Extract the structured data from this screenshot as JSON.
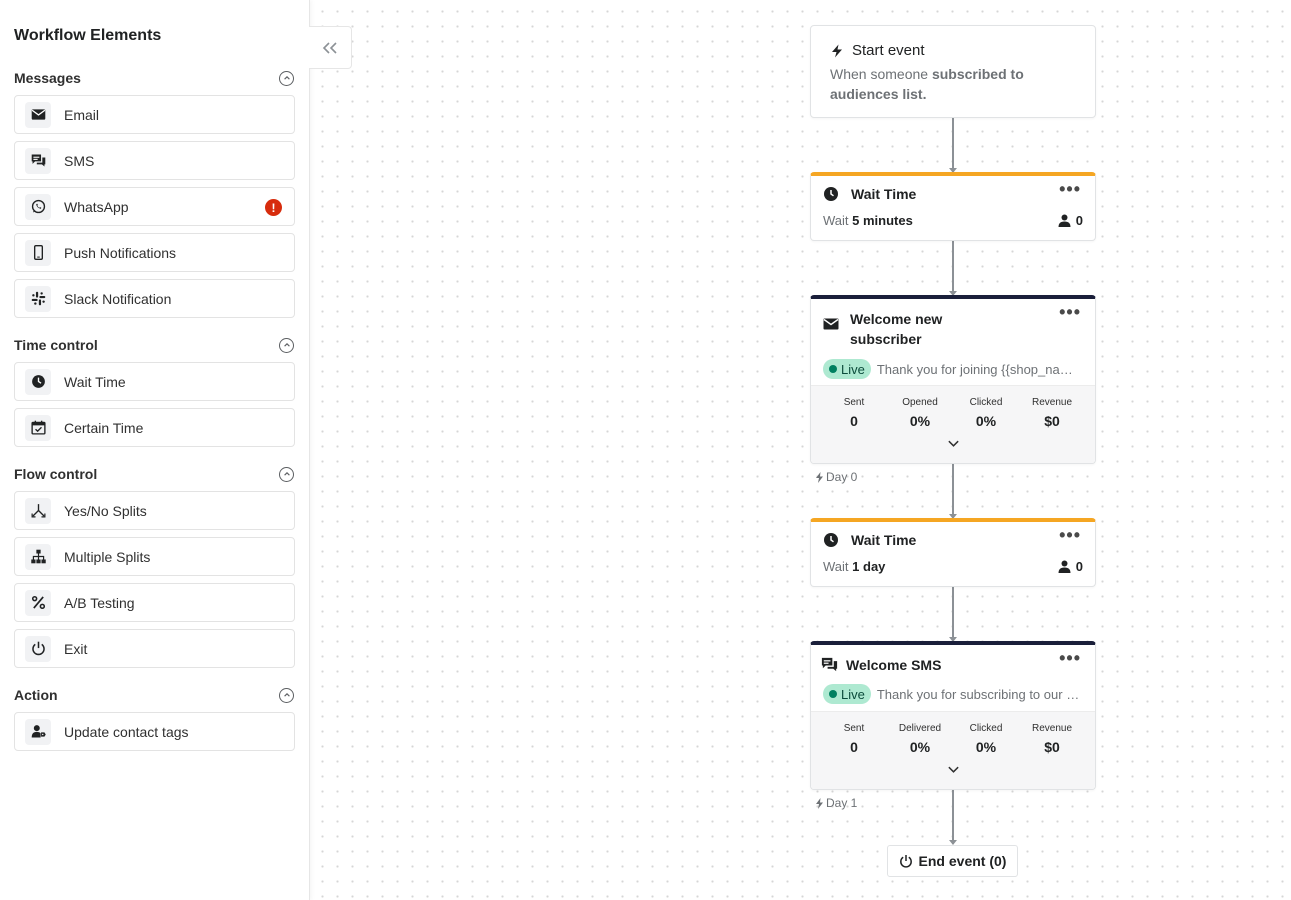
{
  "sidebar": {
    "title": "Workflow Elements",
    "sections": [
      {
        "title": "Messages",
        "items": [
          {
            "label": "Email",
            "icon": "envelope-icon"
          },
          {
            "label": "SMS",
            "icon": "chat-bubbles-icon"
          },
          {
            "label": "WhatsApp",
            "icon": "whatsapp-icon",
            "warning": "!"
          },
          {
            "label": "Push Notifications",
            "icon": "mobile-phone-icon"
          },
          {
            "label": "Slack Notification",
            "icon": "slack-icon"
          }
        ]
      },
      {
        "title": "Time control",
        "items": [
          {
            "label": "Wait Time",
            "icon": "clock-icon"
          },
          {
            "label": "Certain Time",
            "icon": "calendar-check-icon"
          }
        ]
      },
      {
        "title": "Flow control",
        "items": [
          {
            "label": "Yes/No Splits",
            "icon": "split-icon"
          },
          {
            "label": "Multiple Splits",
            "icon": "hierarchy-icon"
          },
          {
            "label": "A/B Testing",
            "icon": "percent-icon"
          },
          {
            "label": "Exit",
            "icon": "power-icon"
          }
        ]
      },
      {
        "title": "Action",
        "items": [
          {
            "label": "Update contact tags",
            "icon": "user-tag-icon"
          }
        ]
      }
    ]
  },
  "flow": {
    "start": {
      "title": "Start event",
      "desc_prefix": "When someone ",
      "desc_bold": "subscribed to audiences list."
    },
    "wait1": {
      "title": "Wait Time",
      "prefix": "Wait",
      "value": "5 minutes",
      "count": "0",
      "menu": "•••"
    },
    "email": {
      "title": "Welcome new subscriber",
      "status": "Live",
      "preview": "Thank you for joining {{shop_name}}",
      "menu": "•••",
      "stats": [
        {
          "label": "Sent",
          "value": "0"
        },
        {
          "label": "Opened",
          "value": "0%"
        },
        {
          "label": "Clicked",
          "value": "0%"
        },
        {
          "label": "Revenue",
          "value": "$0"
        }
      ],
      "day": "Day 0"
    },
    "wait2": {
      "title": "Wait Time",
      "prefix": "Wait",
      "value": "1 day",
      "count": "0",
      "menu": "•••"
    },
    "sms": {
      "title": "Welcome SMS",
      "status": "Live",
      "preview": "Thank you for subscribing to our n...",
      "menu": "•••",
      "stats": [
        {
          "label": "Sent",
          "value": "0"
        },
        {
          "label": "Delivered",
          "value": "0%"
        },
        {
          "label": "Clicked",
          "value": "0%"
        },
        {
          "label": "Revenue",
          "value": "$0"
        }
      ],
      "day": "Day 1"
    },
    "end": {
      "label": "End event (0)"
    }
  },
  "colors": {
    "wait_accent": "#f5a623",
    "message_accent": "#1a1f3a",
    "live_badge_bg": "#aee9d1",
    "live_dot": "#008060",
    "warning": "#d72c0d"
  }
}
